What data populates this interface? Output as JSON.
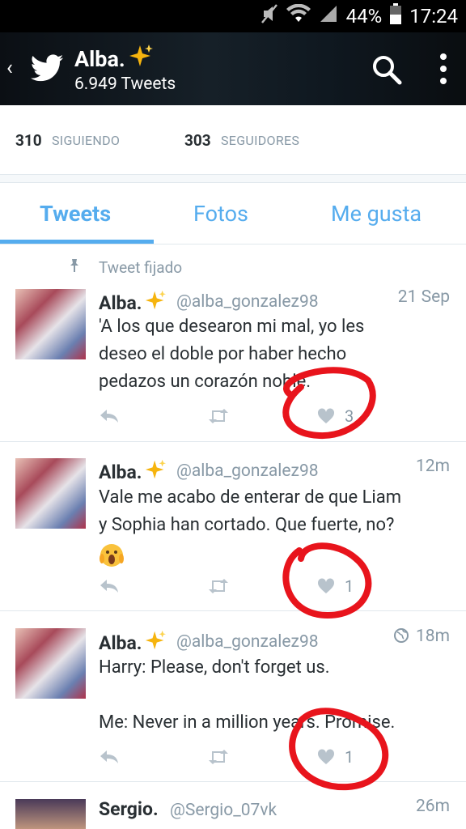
{
  "status_bar": {
    "battery": "44%",
    "time": "17:24"
  },
  "header": {
    "name": "Alba.",
    "tweet_count": "6.949 Tweets"
  },
  "follows": {
    "following_count": "310",
    "following_label": "SIGUIENDO",
    "followers_count": "303",
    "followers_label": "SEGUIDORES"
  },
  "tabs": [
    {
      "label": "Tweets"
    },
    {
      "label": "Fotos"
    },
    {
      "label": "Me gusta"
    }
  ],
  "pinned_label": "Tweet fijado",
  "tweets": [
    {
      "name": "Alba.",
      "handle": "@alba_gonzalez98",
      "time": "21 Sep",
      "text": "'A los que desearon mi mal, yo les\ndeseo el doble por haber hecho\npedazos un corazón noble.",
      "likes": "3"
    },
    {
      "name": "Alba.",
      "handle": "@alba_gonzalez98",
      "time": "12m",
      "text": "Vale me acabo de enterar de que Liam\ny Sophia han cortado. Que fuerte, no?",
      "likes": "1"
    },
    {
      "name": "Alba.",
      "handle": "@alba_gonzalez98",
      "time": "18m",
      "text": "Harry: Please, don't forget us.\n\nMe: Never in a million years. Promise.",
      "likes": "1"
    },
    {
      "name": "Sergio.",
      "handle": "@Sergio_07vk",
      "time": "26m",
      "text": "",
      "likes": ""
    }
  ],
  "colors": {
    "accent": "#55acee",
    "annotation": "#e8141c",
    "header_bg": "#0b0f14"
  }
}
